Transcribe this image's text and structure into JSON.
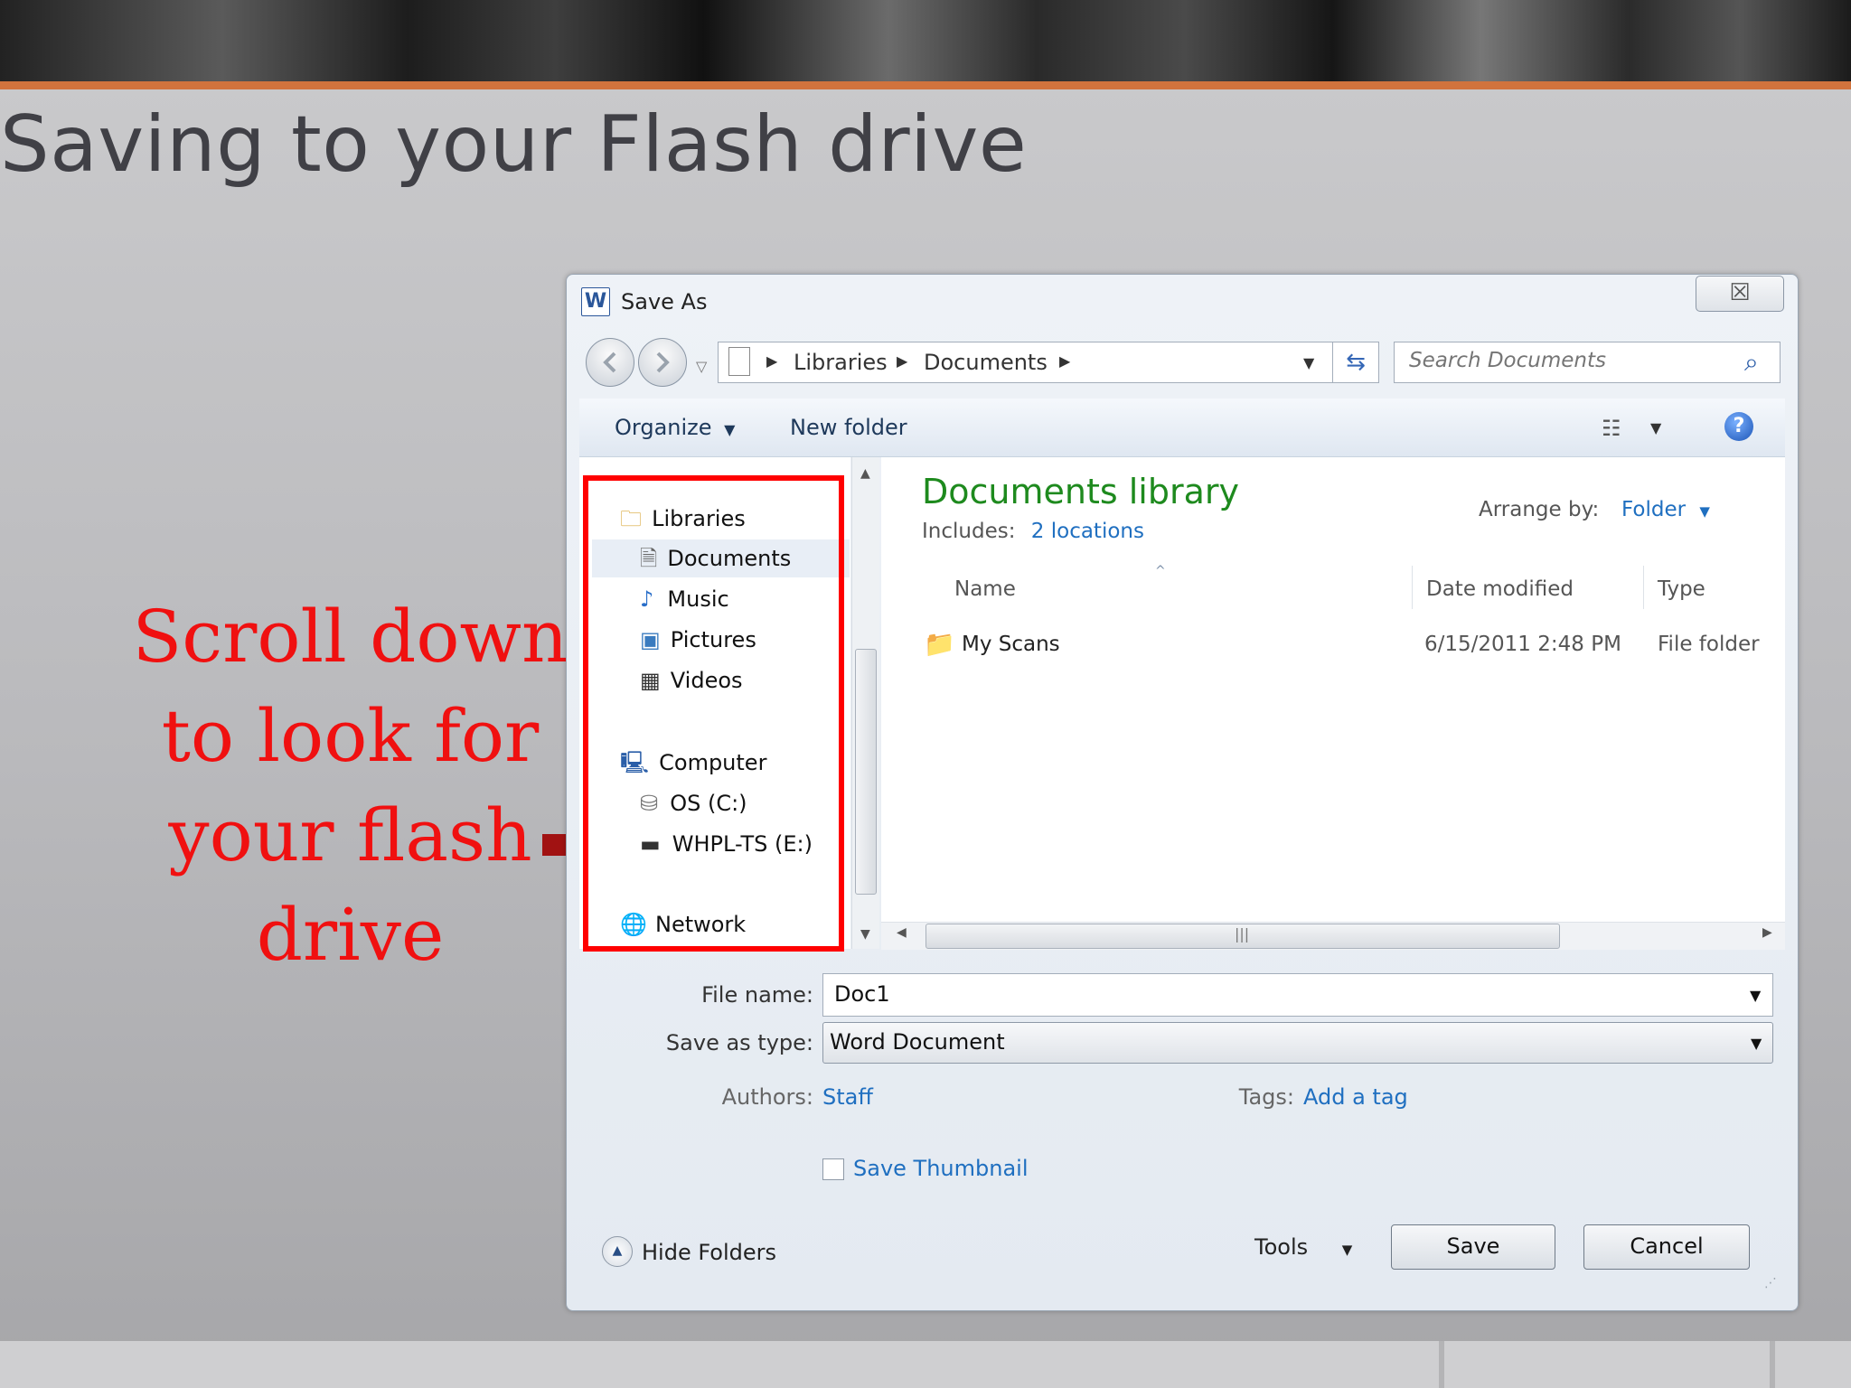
{
  "slide": {
    "title": "Saving to your Flash drive",
    "instruction": "Scroll down to look for your flash drive",
    "accent_color": "#d1733d",
    "instruction_color": "#f01010",
    "highlight_color": "#ff0000"
  },
  "dialog": {
    "title": "Save As",
    "app_icon_letter": "W",
    "close_symbol": "☒",
    "breadcrumb": [
      "Libraries",
      "Documents"
    ],
    "search_placeholder": "Search Documents",
    "toolbar": {
      "organize": "Organize",
      "new_folder": "New folder"
    },
    "nav": {
      "libraries": "Libraries",
      "documents": "Documents",
      "music": "Music",
      "pictures": "Pictures",
      "videos": "Videos",
      "computer": "Computer",
      "os_c": "OS (C:)",
      "flash": "WHPL-TS (E:)",
      "network": "Network"
    },
    "library": {
      "title": "Documents library",
      "includes_label": "Includes:",
      "locations": "2 locations",
      "arrange_label": "Arrange by:",
      "arrange_value": "Folder"
    },
    "columns": {
      "name": "Name",
      "date": "Date modified",
      "type": "Type"
    },
    "files": [
      {
        "name": "My Scans",
        "date": "6/15/2011 2:48 PM",
        "type": "File folder"
      }
    ],
    "form": {
      "file_name_label": "File name:",
      "file_name_value": "Doc1",
      "save_type_label": "Save as type:",
      "save_type_value": "Word Document",
      "authors_label": "Authors:",
      "authors_value": "Staff",
      "tags_label": "Tags:",
      "tags_value": "Add a tag",
      "thumbnail_label": "Save Thumbnail"
    },
    "footer": {
      "hide_folders": "Hide Folders",
      "tools": "Tools",
      "save": "Save",
      "cancel": "Cancel"
    }
  }
}
